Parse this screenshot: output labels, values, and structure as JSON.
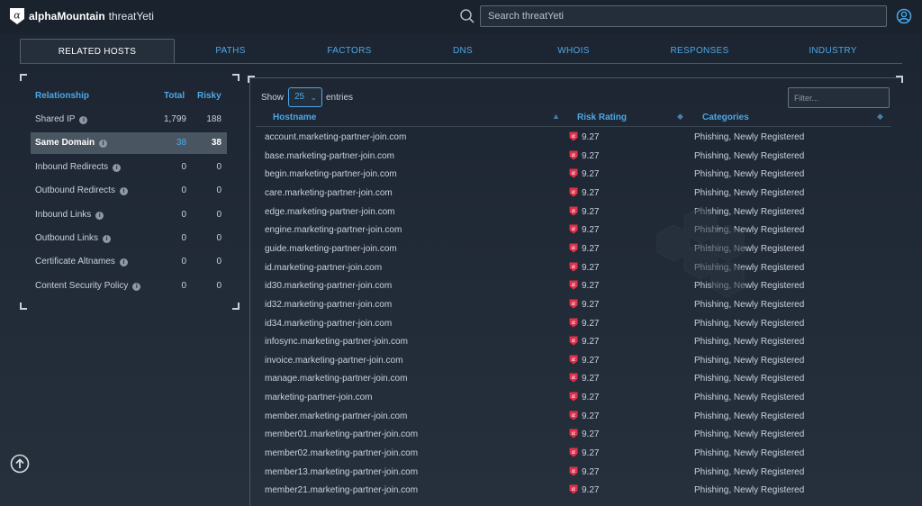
{
  "header": {
    "brand_name": "alphaMountain",
    "product_name": "threatYeti",
    "search_placeholder": "Search threatYeti"
  },
  "tabs": [
    {
      "label": "RELATED HOSTS",
      "active": true
    },
    {
      "label": "PATHS",
      "active": false
    },
    {
      "label": "FACTORS",
      "active": false
    },
    {
      "label": "DNS",
      "active": false
    },
    {
      "label": "WHOIS",
      "active": false
    },
    {
      "label": "RESPONSES",
      "active": false
    },
    {
      "label": "INDUSTRY",
      "active": false
    }
  ],
  "relationships": {
    "headers": {
      "name": "Relationship",
      "total": "Total",
      "risky": "Risky"
    },
    "rows": [
      {
        "name": "Shared IP",
        "total": "1,799",
        "risky": "188",
        "selected": false
      },
      {
        "name": "Same Domain",
        "total": "38",
        "risky": "38",
        "selected": true
      },
      {
        "name": "Inbound Redirects",
        "total": "0",
        "risky": "0",
        "selected": false
      },
      {
        "name": "Outbound Redirects",
        "total": "0",
        "risky": "0",
        "selected": false
      },
      {
        "name": "Inbound Links",
        "total": "0",
        "risky": "0",
        "selected": false
      },
      {
        "name": "Outbound Links",
        "total": "0",
        "risky": "0",
        "selected": false
      },
      {
        "name": "Certificate Altnames",
        "total": "0",
        "risky": "0",
        "selected": false
      },
      {
        "name": "Content Security Policy",
        "total": "0",
        "risky": "0",
        "selected": false
      }
    ]
  },
  "table": {
    "show_label": "Show",
    "entries_value": "25",
    "entries_label": "entries",
    "filter_placeholder": "Filter...",
    "columns": {
      "hostname": "Hostname",
      "risk": "Risk Rating",
      "categories": "Categories"
    },
    "rows": [
      {
        "host": "account.marketing-partner-join.com",
        "risk": "9.27",
        "categories": "Phishing, Newly Registered"
      },
      {
        "host": "base.marketing-partner-join.com",
        "risk": "9.27",
        "categories": "Phishing, Newly Registered"
      },
      {
        "host": "begin.marketing-partner-join.com",
        "risk": "9.27",
        "categories": "Phishing, Newly Registered"
      },
      {
        "host": "care.marketing-partner-join.com",
        "risk": "9.27",
        "categories": "Phishing, Newly Registered"
      },
      {
        "host": "edge.marketing-partner-join.com",
        "risk": "9.27",
        "categories": "Phishing, Newly Registered"
      },
      {
        "host": "engine.marketing-partner-join.com",
        "risk": "9.27",
        "categories": "Phishing, Newly Registered"
      },
      {
        "host": "guide.marketing-partner-join.com",
        "risk": "9.27",
        "categories": "Phishing, Newly Registered"
      },
      {
        "host": "id.marketing-partner-join.com",
        "risk": "9.27",
        "categories": "Phishing, Newly Registered"
      },
      {
        "host": "id30.marketing-partner-join.com",
        "risk": "9.27",
        "categories": "Phishing, Newly Registered"
      },
      {
        "host": "id32.marketing-partner-join.com",
        "risk": "9.27",
        "categories": "Phishing, Newly Registered"
      },
      {
        "host": "id34.marketing-partner-join.com",
        "risk": "9.27",
        "categories": "Phishing, Newly Registered"
      },
      {
        "host": "infosync.marketing-partner-join.com",
        "risk": "9.27",
        "categories": "Phishing, Newly Registered"
      },
      {
        "host": "invoice.marketing-partner-join.com",
        "risk": "9.27",
        "categories": "Phishing, Newly Registered"
      },
      {
        "host": "manage.marketing-partner-join.com",
        "risk": "9.27",
        "categories": "Phishing, Newly Registered"
      },
      {
        "host": "marketing-partner-join.com",
        "risk": "9.27",
        "categories": "Phishing, Newly Registered"
      },
      {
        "host": "member.marketing-partner-join.com",
        "risk": "9.27",
        "categories": "Phishing, Newly Registered"
      },
      {
        "host": "member01.marketing-partner-join.com",
        "risk": "9.27",
        "categories": "Phishing, Newly Registered"
      },
      {
        "host": "member02.marketing-partner-join.com",
        "risk": "9.27",
        "categories": "Phishing, Newly Registered"
      },
      {
        "host": "member13.marketing-partner-join.com",
        "risk": "9.27",
        "categories": "Phishing, Newly Registered"
      },
      {
        "host": "member21.marketing-partner-join.com",
        "risk": "9.27",
        "categories": "Phishing, Newly Registered"
      }
    ]
  },
  "colors": {
    "accent": "#4ba8e8",
    "risk_badge": "#e0314b",
    "background": "#1f2937"
  },
  "icons": {
    "logo": "alpha-logo-icon",
    "search": "search-icon",
    "user": "user-icon",
    "info": "info-icon",
    "risk": "risk-badge-icon",
    "scroll_top": "arrow-up-circle-icon"
  }
}
